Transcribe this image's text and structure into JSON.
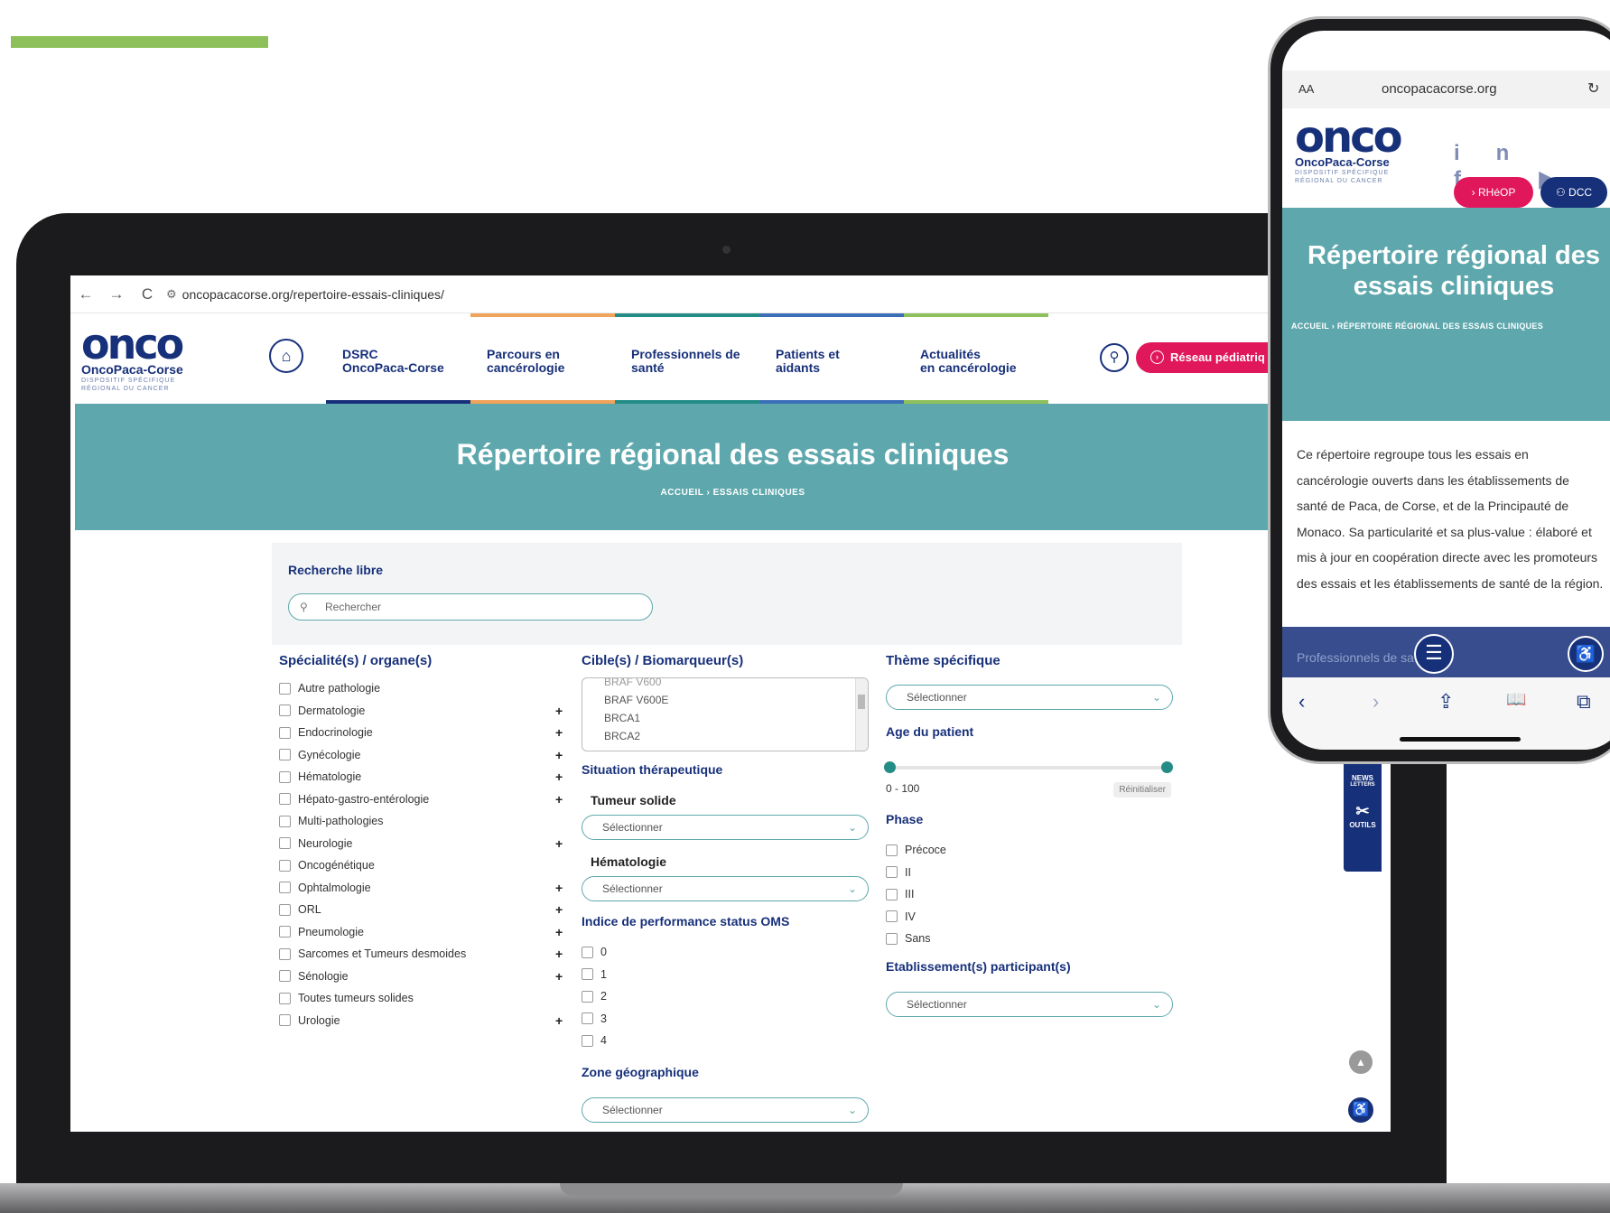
{
  "colors": {
    "navy": "#17307a",
    "teal": "#5ea8ad",
    "pink": "#e1175c",
    "green": "#8dc05a"
  },
  "browser": {
    "url": "oncopacacorse.org/repertoire-essais-cliniques/",
    "back_icon": "←",
    "forward_icon": "→",
    "reload_icon": "C",
    "site_icon": "⚙",
    "zoom_icon": "⚲",
    "star_icon": "☆"
  },
  "logo": {
    "mark": "onco",
    "name": "OncoPaca-Corse",
    "sub1": "DISPOSITIF SPÉCIFIQUE",
    "sub2": "RÉGIONAL DU CANCER"
  },
  "nav": {
    "home_icon": "⌂",
    "items": [
      {
        "line1": "DSRC",
        "line2": "OncoPaca-Corse",
        "color": "#17307a"
      },
      {
        "line1": "Parcours en",
        "line2": "cancérologie",
        "color": "#f0a35a"
      },
      {
        "line1": "Professionnels de",
        "line2": "santé",
        "color": "#238c86"
      },
      {
        "line1": "Patients et",
        "line2": "aidants",
        "color": "#3a6fb8"
      },
      {
        "line1": "Actualités",
        "line2": "en cancérologie",
        "color": "#8dc05a"
      }
    ],
    "search_icon": "⚲",
    "reseau_label": "Réseau pédiatriq"
  },
  "hero": {
    "title": "Répertoire régional des essais cliniques",
    "breadcrumb": "ACCUEIL › ESSAIS CLINIQUES"
  },
  "search": {
    "label": "Recherche libre",
    "placeholder": "Rechercher",
    "icon": "⚲"
  },
  "specialites": {
    "title": "Spécialité(s) / organe(s)",
    "items": [
      {
        "label": "Autre pathologie",
        "plus": ""
      },
      {
        "label": "Dermatologie",
        "plus": "+"
      },
      {
        "label": "Endocrinologie",
        "plus": "+"
      },
      {
        "label": "Gynécologie",
        "plus": "+"
      },
      {
        "label": "Hématologie",
        "plus": "+"
      },
      {
        "label": "Hépato-gastro-entérologie",
        "plus": "+"
      },
      {
        "label": "Multi-pathologies",
        "plus": ""
      },
      {
        "label": "Neurologie",
        "plus": "+"
      },
      {
        "label": "Oncogénétique",
        "plus": ""
      },
      {
        "label": "Ophtalmologie",
        "plus": "+"
      },
      {
        "label": "ORL",
        "plus": "+"
      },
      {
        "label": "Pneumologie",
        "plus": "+"
      },
      {
        "label": "Sarcomes et Tumeurs desmoides",
        "plus": "+"
      },
      {
        "label": "Sénologie",
        "plus": "+"
      },
      {
        "label": "Toutes tumeurs solides",
        "plus": ""
      },
      {
        "label": "Urologie",
        "plus": "+"
      }
    ]
  },
  "cibles": {
    "title": "Cible(s) / Biomarqueur(s)",
    "options": [
      "BRAF V600",
      "BRAF V600E",
      "BRCA1",
      "BRCA2"
    ],
    "situation_title": "Situation thérapeutique",
    "tumeur_label": "Tumeur solide",
    "tumeur_value": "Sélectionner",
    "hemato_label": "Hématologie",
    "hemato_value": "Sélectionner",
    "oms_title": "Indice de performance status OMS",
    "oms_items": [
      "0",
      "1",
      "2",
      "3",
      "4"
    ],
    "zone_title": "Zone géographique",
    "zone_value": "Sélectionner"
  },
  "theme": {
    "title": "Thème spécifique",
    "value": "Sélectionner",
    "age_title": "Age du patient",
    "age_min": 0,
    "age_max": 100,
    "age_range": "0 - 100",
    "reset_label": "Réinitialiser",
    "phase_title": "Phase",
    "phases": [
      "Précoce",
      "II",
      "III",
      "IV",
      "Sans"
    ],
    "etab_title": "Etablissement(s) participant(s)",
    "etab_value": "Sélectionner",
    "chevron": "⌄"
  },
  "side_widget": {
    "news1": "NEWS",
    "news2": "LETTERS",
    "outils": "OUTILS",
    "arrow_icon": "◀",
    "tools_icon": "✂",
    "up_icon": "▲",
    "access_icon": "♿"
  },
  "phone": {
    "aa": "AA",
    "url": "oncopacacorse.org",
    "reload_icon": "↻",
    "social": "in f ▶",
    "rheop_label": "RHéOP",
    "dcc_label": "DCC",
    "hero_title": "Répertoire régional des essais cliniques",
    "breadcrumb": "ACCUEIL › RÉPERTOIRE RÉGIONAL DES ESSAIS CLINIQUES",
    "body": "Ce répertoire regroupe tous les essais en cancérologie ouverts dans les établissements de santé de Paca, de Corse, et de la Principauté de Monaco. Sa particularité et sa plus-value : élaboré et mis à jour en coopération directe avec les promoteurs des essais et les établissements de santé de la région.",
    "overlay_text": "Professionnels de sa",
    "menu_icon": "☰",
    "access_icon": "♿",
    "tb_back": "‹",
    "tb_forward": "›",
    "tb_share": "⇪",
    "tb_book": "📖",
    "tb_tabs": "⧉"
  }
}
